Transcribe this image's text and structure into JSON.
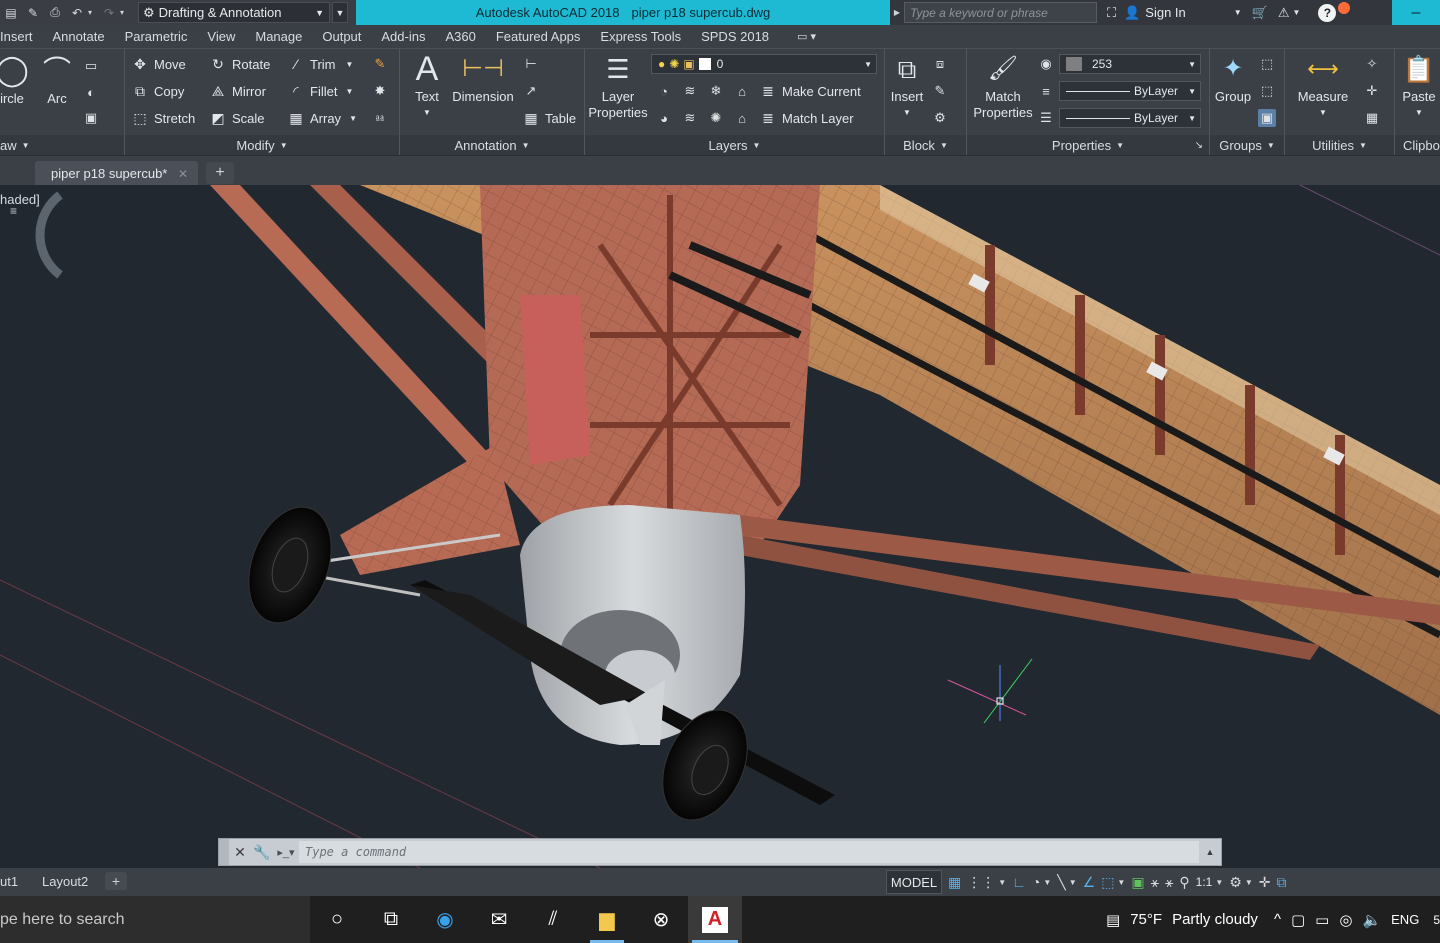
{
  "titlebar": {
    "workspace": "Drafting & Annotation",
    "app_title": "Autodesk AutoCAD 2018",
    "file_title": "piper p18 supercub.dwg",
    "search_placeholder": "Type a keyword or phrase",
    "sign_in": "Sign In",
    "accent_color": "#1eb9d3"
  },
  "ribbon_tabs": [
    "Insert",
    "Annotate",
    "Parametric",
    "View",
    "Manage",
    "Output",
    "Add-ins",
    "A360",
    "Featured Apps",
    "Express Tools",
    "SPDS 2018"
  ],
  "ribbon": {
    "draw": {
      "circle": "ircle",
      "arc": "Arc",
      "footer": "aw"
    },
    "modify": {
      "move": "Move",
      "rotate": "Rotate",
      "trim": "Trim",
      "copy": "Copy",
      "mirror": "Mirror",
      "fillet": "Fillet",
      "stretch": "Stretch",
      "scale": "Scale",
      "array": "Array",
      "footer": "Modify"
    },
    "annotation": {
      "text": "Text",
      "dimension": "Dimension",
      "table": "Table",
      "footer": "Annotation"
    },
    "layers": {
      "layer_properties_1": "Layer",
      "layer_properties_2": "Properties",
      "layer_combo": "0",
      "make_current": "Make Current",
      "match_layer": "Match Layer",
      "footer": "Layers"
    },
    "block": {
      "insert": "Insert",
      "footer": "Block"
    },
    "properties": {
      "match_1": "Match",
      "match_2": "Properties",
      "color_combo": "253",
      "linetype_combo": "ByLayer",
      "lineweight_combo": "ByLayer",
      "footer": "Properties"
    },
    "groups": {
      "group": "Group",
      "footer": "Groups"
    },
    "utilities": {
      "measure": "Measure",
      "footer": "Utilities"
    },
    "clipboard": {
      "paste": "Paste",
      "footer": "Clipbo"
    }
  },
  "file_tab": {
    "name": "piper p18 supercub*"
  },
  "viewport": {
    "style_label": "haded]"
  },
  "command_line": {
    "placeholder": "Type  a  command"
  },
  "layout_tabs": [
    "ut1",
    "Layout2"
  ],
  "status_bar": {
    "model": "MODEL",
    "scale": "1:1"
  },
  "taskbar": {
    "search": "pe here to search",
    "weather_temp": "75°F",
    "weather_desc": "Partly cloudy",
    "language": "ENG",
    "clock_fragment": "5"
  }
}
